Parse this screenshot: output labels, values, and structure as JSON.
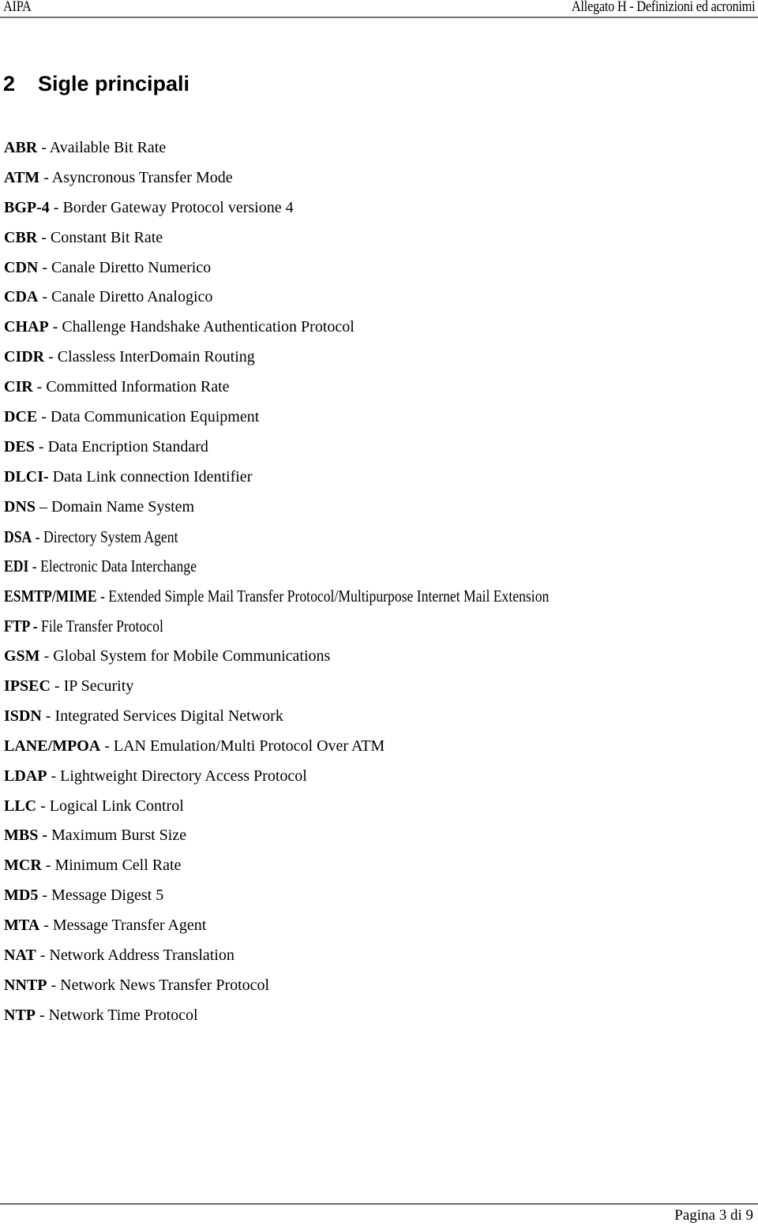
{
  "header": {
    "left": "AIPA",
    "right": "Allegato H - Definizioni ed acronimi"
  },
  "section": {
    "number": "2",
    "title": "Sigle principali"
  },
  "acronyms": [
    {
      "abbr": "ABR",
      "sep": " - ",
      "text": "Available Bit Rate"
    },
    {
      "abbr": "ATM",
      "sep": " - ",
      "text": "Asyncronous Transfer Mode"
    },
    {
      "abbr": "BGP-4",
      "sep": " - ",
      "text": "Border Gateway Protocol versione 4"
    },
    {
      "abbr": "CBR",
      "sep": " - ",
      "text": "Constant Bit Rate"
    },
    {
      "abbr": "CDN",
      "sep": " - ",
      "text": "Canale Diretto Numerico"
    },
    {
      "abbr": "CDA",
      "sep": " - ",
      "text": "Canale Diretto Analogico"
    },
    {
      "abbr": "CHAP",
      "sep": " - ",
      "text": "Challenge Handshake Authentication Protocol"
    },
    {
      "abbr": "CIDR",
      "sep": " - ",
      "text": "Classless InterDomain Routing"
    },
    {
      "abbr": "CIR",
      "sep": " - ",
      "text": "Committed Information Rate"
    },
    {
      "abbr": "DCE",
      "sep": " - ",
      "text": "Data Communication Equipment"
    },
    {
      "abbr": "DES",
      "sep": " - ",
      "text": "Data Encription Standard"
    },
    {
      "abbr": "DLCI-",
      "sep": " ",
      "text": "Data Link connection Identifier"
    },
    {
      "abbr": "DNS",
      "sep": " – ",
      "text": "Domain Name System"
    },
    {
      "abbr": "DSA",
      "sep": " - ",
      "text": "Directory System Agent"
    },
    {
      "abbr": "EDI",
      "sep": " - ",
      "text": "Electronic Data Interchange"
    },
    {
      "abbr": "ESMTP/MIME",
      "sep": " - ",
      "text": "Extended Simple Mail Transfer Protocol/Multipurpose Internet Mail Extension"
    },
    {
      "abbr": "FTP -",
      "sep": " ",
      "text": "File Transfer Protocol"
    },
    {
      "abbr": "GSM",
      "sep": " - ",
      "text": "Global System for Mobile Communications"
    },
    {
      "abbr": "IPSEC",
      "sep": " - ",
      "text": "IP Security"
    },
    {
      "abbr": "ISDN",
      "sep": " - ",
      "text": "Integrated Services Digital Network"
    },
    {
      "abbr": "LANE/MPOA",
      "sep": " - ",
      "text": "LAN Emulation/Multi Protocol Over ATM"
    },
    {
      "abbr": "LDAP",
      "sep": " - ",
      "text": "Lightweight Directory Access Protocol"
    },
    {
      "abbr": "LLC",
      "sep": " - ",
      "text": "Logical Link Control"
    },
    {
      "abbr": "MBS -",
      "sep": " ",
      "text": "Maximum Burst Size"
    },
    {
      "abbr": "MCR",
      "sep": " - ",
      "text": "Minimum Cell Rate"
    },
    {
      "abbr": "MD5",
      "sep": " - ",
      "text": "Message Digest 5"
    },
    {
      "abbr": "MTA",
      "sep": " - ",
      "text": "Message Transfer Agent"
    },
    {
      "abbr": "NAT",
      "sep": " - ",
      "text": "Network Address Translation"
    },
    {
      "abbr": "NNTP",
      "sep": " - ",
      "text": "Network News Transfer Protocol"
    },
    {
      "abbr": "NTP",
      "sep": " - ",
      "text": "Network Time Protocol"
    }
  ],
  "footer": {
    "page": "Pagina 3 di 9"
  }
}
